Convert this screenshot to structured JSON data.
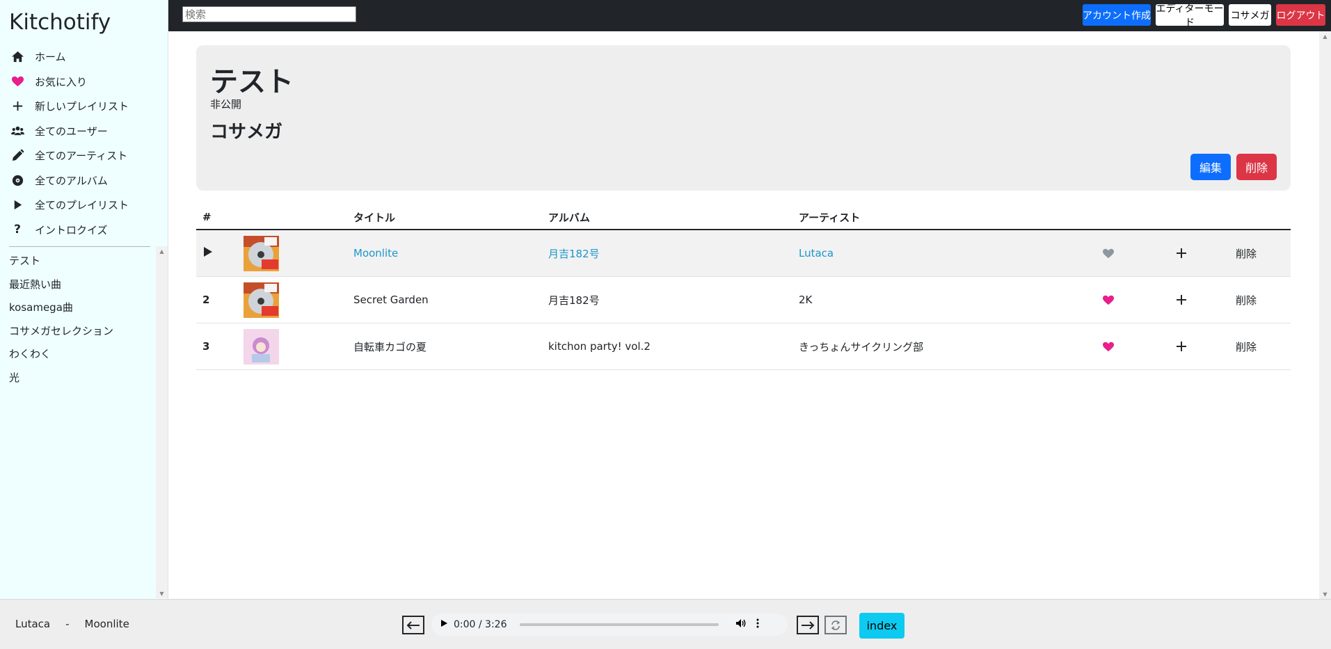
{
  "app": {
    "brand": "Kitchotify"
  },
  "sidebar": {
    "nav": [
      {
        "label": "ホーム",
        "icon": "home-icon"
      },
      {
        "label": "お気に入り",
        "icon": "heart-icon"
      },
      {
        "label": "新しいプレイリスト",
        "icon": "plus-icon"
      },
      {
        "label": "全てのユーザー",
        "icon": "users-icon"
      },
      {
        "label": "全てのアーティスト",
        "icon": "pencil-icon"
      },
      {
        "label": "全てのアルバム",
        "icon": "disc-icon"
      },
      {
        "label": "全てのプレイリスト",
        "icon": "play-icon"
      },
      {
        "label": "イントロクイズ",
        "icon": "question-icon"
      }
    ],
    "playlists": [
      "テスト",
      "最近熱い曲",
      "kosamega曲",
      "コサメガセレクション",
      "わくわく",
      "光"
    ]
  },
  "topbar": {
    "search_placeholder": "検索",
    "create_account": "アカウント作成",
    "editor_mode": "エディターモード",
    "user": "コサメガ",
    "logout": "ログアウト"
  },
  "playlist": {
    "title": "テスト",
    "visibility": "非公開",
    "owner": "コサメガ",
    "edit_label": "編集",
    "delete_label": "削除"
  },
  "table": {
    "headers": {
      "num": "#",
      "title": "タイトル",
      "album": "アルバム",
      "artist": "アーティスト"
    },
    "rows": [
      {
        "num": "",
        "playing": true,
        "title": "Moonlite",
        "album": "月吉182号",
        "artist": "Lutaca",
        "favorite": false,
        "delete": "削除"
      },
      {
        "num": "2",
        "playing": false,
        "title": "Secret Garden",
        "album": "月吉182号",
        "artist": "2K",
        "favorite": true,
        "delete": "削除"
      },
      {
        "num": "3",
        "playing": false,
        "title": "自転車カゴの夏",
        "album": "kitchon party! vol.2",
        "artist": "きっちょんサイクリング部",
        "favorite": true,
        "delete": "削除"
      }
    ]
  },
  "player": {
    "artist": "Lutaca",
    "separator": "-",
    "track": "Moonlite",
    "time": "0:00 / 3:26",
    "index_label": "index"
  },
  "colors": {
    "primary": "#0d6efd",
    "danger": "#dc3545",
    "link": "#1b95c9",
    "heart": "#e91e8c",
    "heart_off": "#8f979e",
    "info": "#0dcaf0",
    "sidebar_bg": "#efffff"
  }
}
